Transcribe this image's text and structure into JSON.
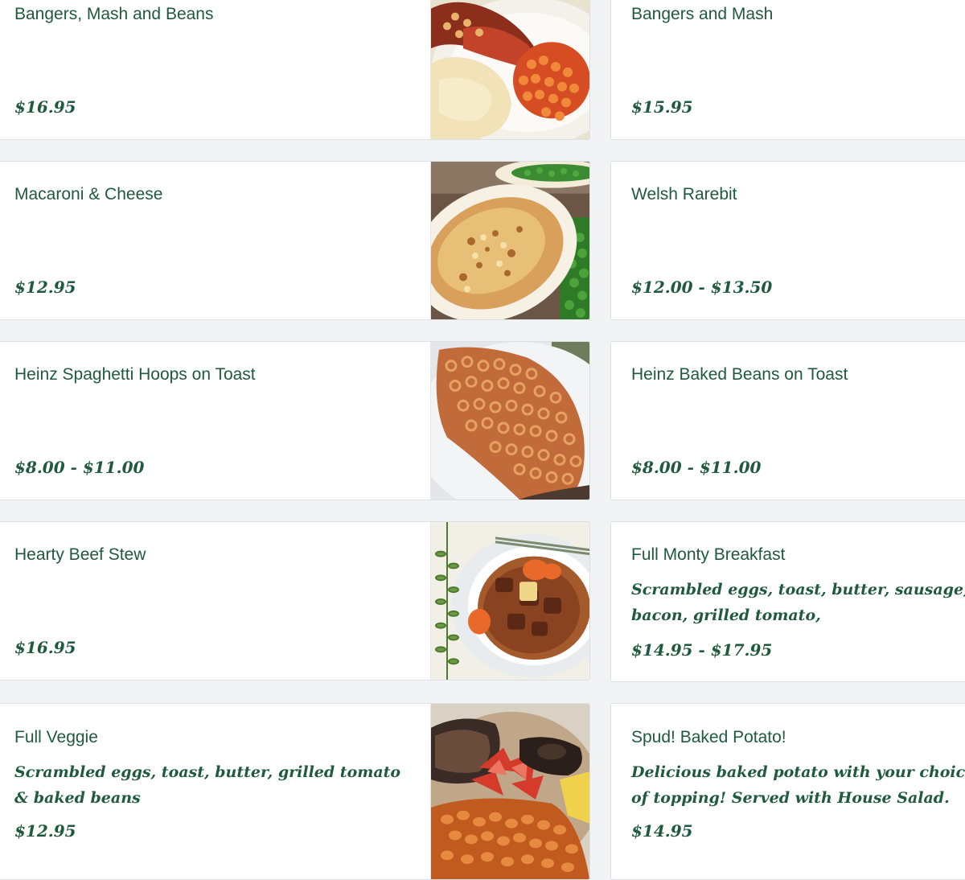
{
  "menu": {
    "items": [
      {
        "name": "Bangers, Mash and Beans",
        "description": "",
        "price": "$16.95",
        "photo": "bangers-mash-beans-photo"
      },
      {
        "name": "Bangers and Mash",
        "description": "",
        "price": "$15.95",
        "photo": ""
      },
      {
        "name": "Macaroni & Cheese",
        "description": "",
        "price": "$12.95",
        "photo": "macaroni-cheese-photo"
      },
      {
        "name": "Welsh Rarebit",
        "description": "",
        "price": "$12.00 - $13.50",
        "photo": ""
      },
      {
        "name": "Heinz Spaghetti Hoops on Toast",
        "description": "",
        "price": "$8.00 - $11.00",
        "photo": "spaghetti-hoops-photo"
      },
      {
        "name": "Heinz Baked Beans on Toast",
        "description": "",
        "price": "$8.00 - $11.00",
        "photo": ""
      },
      {
        "name": "Hearty Beef Stew",
        "description": "",
        "price": "$16.95",
        "photo": "beef-stew-photo"
      },
      {
        "name": "Full Monty Breakfast",
        "description": "Scrambled eggs, toast, butter, sausage, bacon, grilled tomato,",
        "price": "$14.95 - $17.95",
        "photo": ""
      },
      {
        "name": "Full Veggie",
        "description": "Scrambled eggs, toast, butter, grilled tomato & baked beans",
        "price": "$12.95",
        "photo": "full-veggie-photo"
      },
      {
        "name": "Spud! Baked Potato!",
        "description": "Delicious baked potato with your choice of topping! Served with House Salad.",
        "price": "$14.95",
        "photo": ""
      }
    ]
  },
  "colors": {
    "text_green": "#1f5a3d",
    "card_background": "#ffffff",
    "page_background": "#f2f3f5",
    "card_border": "#dcdfe3"
  }
}
